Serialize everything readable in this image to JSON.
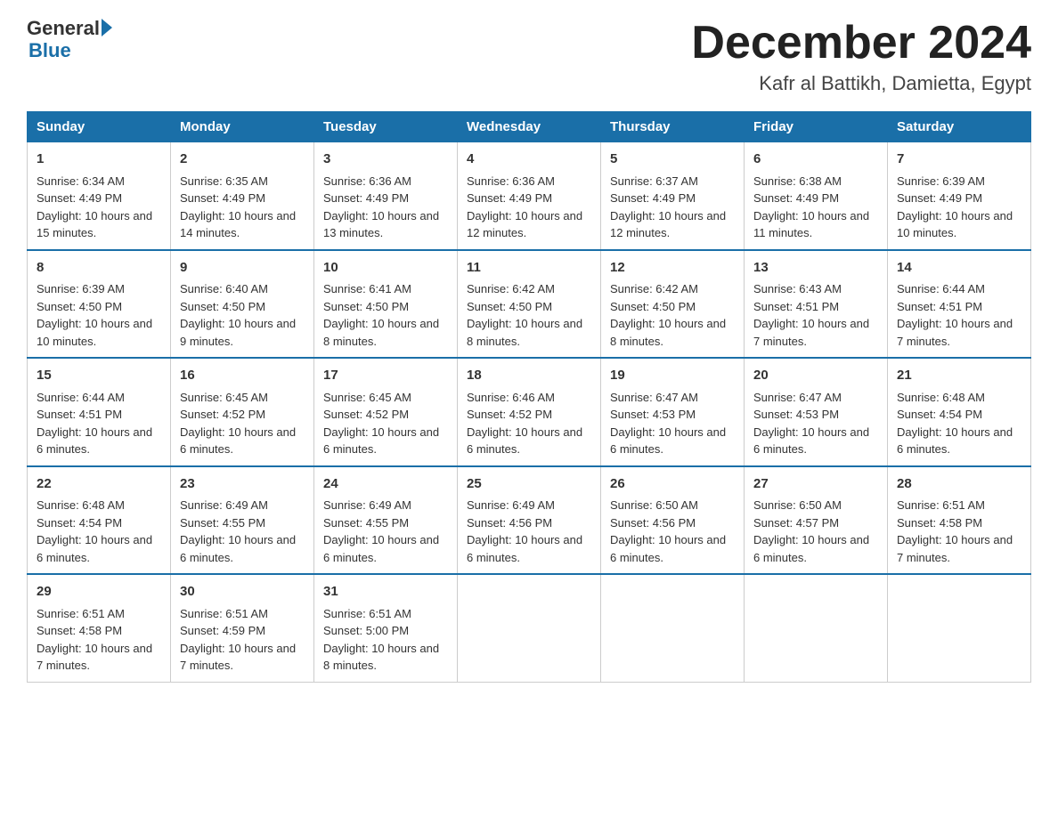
{
  "header": {
    "logo_line1": "General",
    "logo_line2": "Blue",
    "month": "December 2024",
    "location": "Kafr al Battikh, Damietta, Egypt"
  },
  "days_of_week": [
    "Sunday",
    "Monday",
    "Tuesday",
    "Wednesday",
    "Thursday",
    "Friday",
    "Saturday"
  ],
  "weeks": [
    [
      {
        "day": "1",
        "sunrise": "Sunrise: 6:34 AM",
        "sunset": "Sunset: 4:49 PM",
        "daylight": "Daylight: 10 hours and 15 minutes."
      },
      {
        "day": "2",
        "sunrise": "Sunrise: 6:35 AM",
        "sunset": "Sunset: 4:49 PM",
        "daylight": "Daylight: 10 hours and 14 minutes."
      },
      {
        "day": "3",
        "sunrise": "Sunrise: 6:36 AM",
        "sunset": "Sunset: 4:49 PM",
        "daylight": "Daylight: 10 hours and 13 minutes."
      },
      {
        "day": "4",
        "sunrise": "Sunrise: 6:36 AM",
        "sunset": "Sunset: 4:49 PM",
        "daylight": "Daylight: 10 hours and 12 minutes."
      },
      {
        "day": "5",
        "sunrise": "Sunrise: 6:37 AM",
        "sunset": "Sunset: 4:49 PM",
        "daylight": "Daylight: 10 hours and 12 minutes."
      },
      {
        "day": "6",
        "sunrise": "Sunrise: 6:38 AM",
        "sunset": "Sunset: 4:49 PM",
        "daylight": "Daylight: 10 hours and 11 minutes."
      },
      {
        "day": "7",
        "sunrise": "Sunrise: 6:39 AM",
        "sunset": "Sunset: 4:49 PM",
        "daylight": "Daylight: 10 hours and 10 minutes."
      }
    ],
    [
      {
        "day": "8",
        "sunrise": "Sunrise: 6:39 AM",
        "sunset": "Sunset: 4:50 PM",
        "daylight": "Daylight: 10 hours and 10 minutes."
      },
      {
        "day": "9",
        "sunrise": "Sunrise: 6:40 AM",
        "sunset": "Sunset: 4:50 PM",
        "daylight": "Daylight: 10 hours and 9 minutes."
      },
      {
        "day": "10",
        "sunrise": "Sunrise: 6:41 AM",
        "sunset": "Sunset: 4:50 PM",
        "daylight": "Daylight: 10 hours and 8 minutes."
      },
      {
        "day": "11",
        "sunrise": "Sunrise: 6:42 AM",
        "sunset": "Sunset: 4:50 PM",
        "daylight": "Daylight: 10 hours and 8 minutes."
      },
      {
        "day": "12",
        "sunrise": "Sunrise: 6:42 AM",
        "sunset": "Sunset: 4:50 PM",
        "daylight": "Daylight: 10 hours and 8 minutes."
      },
      {
        "day": "13",
        "sunrise": "Sunrise: 6:43 AM",
        "sunset": "Sunset: 4:51 PM",
        "daylight": "Daylight: 10 hours and 7 minutes."
      },
      {
        "day": "14",
        "sunrise": "Sunrise: 6:44 AM",
        "sunset": "Sunset: 4:51 PM",
        "daylight": "Daylight: 10 hours and 7 minutes."
      }
    ],
    [
      {
        "day": "15",
        "sunrise": "Sunrise: 6:44 AM",
        "sunset": "Sunset: 4:51 PM",
        "daylight": "Daylight: 10 hours and 6 minutes."
      },
      {
        "day": "16",
        "sunrise": "Sunrise: 6:45 AM",
        "sunset": "Sunset: 4:52 PM",
        "daylight": "Daylight: 10 hours and 6 minutes."
      },
      {
        "day": "17",
        "sunrise": "Sunrise: 6:45 AM",
        "sunset": "Sunset: 4:52 PM",
        "daylight": "Daylight: 10 hours and 6 minutes."
      },
      {
        "day": "18",
        "sunrise": "Sunrise: 6:46 AM",
        "sunset": "Sunset: 4:52 PM",
        "daylight": "Daylight: 10 hours and 6 minutes."
      },
      {
        "day": "19",
        "sunrise": "Sunrise: 6:47 AM",
        "sunset": "Sunset: 4:53 PM",
        "daylight": "Daylight: 10 hours and 6 minutes."
      },
      {
        "day": "20",
        "sunrise": "Sunrise: 6:47 AM",
        "sunset": "Sunset: 4:53 PM",
        "daylight": "Daylight: 10 hours and 6 minutes."
      },
      {
        "day": "21",
        "sunrise": "Sunrise: 6:48 AM",
        "sunset": "Sunset: 4:54 PM",
        "daylight": "Daylight: 10 hours and 6 minutes."
      }
    ],
    [
      {
        "day": "22",
        "sunrise": "Sunrise: 6:48 AM",
        "sunset": "Sunset: 4:54 PM",
        "daylight": "Daylight: 10 hours and 6 minutes."
      },
      {
        "day": "23",
        "sunrise": "Sunrise: 6:49 AM",
        "sunset": "Sunset: 4:55 PM",
        "daylight": "Daylight: 10 hours and 6 minutes."
      },
      {
        "day": "24",
        "sunrise": "Sunrise: 6:49 AM",
        "sunset": "Sunset: 4:55 PM",
        "daylight": "Daylight: 10 hours and 6 minutes."
      },
      {
        "day": "25",
        "sunrise": "Sunrise: 6:49 AM",
        "sunset": "Sunset: 4:56 PM",
        "daylight": "Daylight: 10 hours and 6 minutes."
      },
      {
        "day": "26",
        "sunrise": "Sunrise: 6:50 AM",
        "sunset": "Sunset: 4:56 PM",
        "daylight": "Daylight: 10 hours and 6 minutes."
      },
      {
        "day": "27",
        "sunrise": "Sunrise: 6:50 AM",
        "sunset": "Sunset: 4:57 PM",
        "daylight": "Daylight: 10 hours and 6 minutes."
      },
      {
        "day": "28",
        "sunrise": "Sunrise: 6:51 AM",
        "sunset": "Sunset: 4:58 PM",
        "daylight": "Daylight: 10 hours and 7 minutes."
      }
    ],
    [
      {
        "day": "29",
        "sunrise": "Sunrise: 6:51 AM",
        "sunset": "Sunset: 4:58 PM",
        "daylight": "Daylight: 10 hours and 7 minutes."
      },
      {
        "day": "30",
        "sunrise": "Sunrise: 6:51 AM",
        "sunset": "Sunset: 4:59 PM",
        "daylight": "Daylight: 10 hours and 7 minutes."
      },
      {
        "day": "31",
        "sunrise": "Sunrise: 6:51 AM",
        "sunset": "Sunset: 5:00 PM",
        "daylight": "Daylight: 10 hours and 8 minutes."
      },
      null,
      null,
      null,
      null
    ]
  ]
}
